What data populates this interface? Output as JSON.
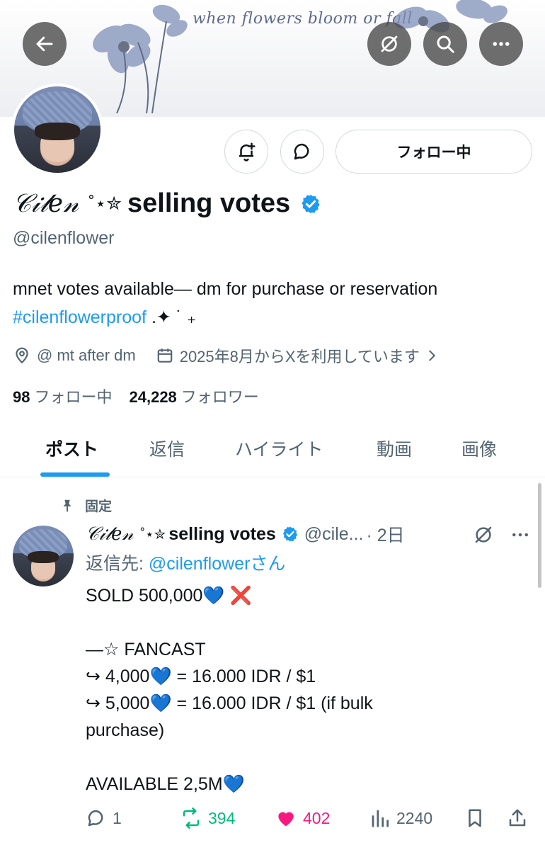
{
  "banner": {
    "text": "when flowers bloom or fall"
  },
  "profile": {
    "display_script": "𝒞𝒾𝓁𝑒𝓃",
    "display_deco": "˚⋆✮",
    "display_bold": "selling votes",
    "handle": "@cilenflower",
    "bio_text": "mnet votes available— dm for purchase or reservation",
    "bio_hashtag": "#cilenflowerproof",
    "bio_deco": " .✦ ˙ ₊",
    "location": "@ mt after dm",
    "joined": "2025年8月からXを利用しています",
    "following_count": "98",
    "following_label": "フォロー中",
    "followers_count": "24,228",
    "followers_label": "フォロワー",
    "follow_button": "フォロー中"
  },
  "tabs": [
    {
      "label": "ポスト"
    },
    {
      "label": "返信"
    },
    {
      "label": "ハイライト"
    },
    {
      "label": "動画"
    },
    {
      "label": "画像"
    }
  ],
  "post": {
    "pinned_label": "固定",
    "author_script": "𝒞𝒾𝓁𝑒𝓃",
    "author_deco": "˚⋆✮",
    "author_bold": "selling votes",
    "author_handle": "@cile...",
    "time": "· 2日",
    "reply_prefix": "返信先:",
    "reply_handle": "@cilenflower",
    "reply_suffix": "さん",
    "body": "SOLD 500,000💙 ❌\n\n—☆ FANCAST\n↪ 4,000💙 = 16.000 IDR / $1\n↪ 5,000💙 = 16.000 IDR / $1 (if bulk purchase)\n\nAVAILABLE 2,5M💙",
    "replies": "1",
    "reposts": "394",
    "likes": "402",
    "views": "2240"
  },
  "colors": {
    "accent": "#1d9bf0",
    "repost": "#00ba7c",
    "like": "#f91880",
    "muted": "#536471"
  }
}
